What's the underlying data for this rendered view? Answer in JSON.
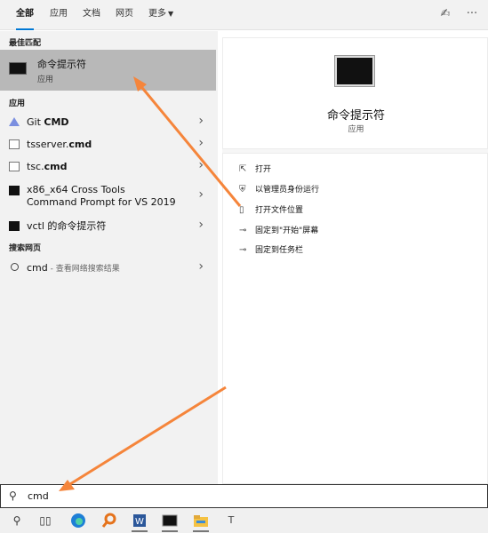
{
  "tabs": [
    {
      "label": "全部"
    },
    {
      "label": "应用"
    },
    {
      "label": "文档"
    },
    {
      "label": "网页"
    },
    {
      "label": "更多"
    }
  ],
  "sections": {
    "best_match": "最佳匹配",
    "apps": "应用",
    "web": "搜索网页"
  },
  "best_match": {
    "title": "命令提示符",
    "subtitle": "应用"
  },
  "apps": [
    {
      "prefix": "Git ",
      "bold": "CMD",
      "suffix": "",
      "icon": "git-icon"
    },
    {
      "prefix": "tsserver.",
      "bold": "cmd",
      "suffix": "",
      "icon": "file-icon"
    },
    {
      "prefix": "tsc.",
      "bold": "cmd",
      "suffix": "",
      "icon": "file-icon"
    },
    {
      "prefix": "x86_x64 Cross Tools Command Prompt for VS 2019",
      "bold": "",
      "suffix": "",
      "icon": "terminal-icon"
    },
    {
      "prefix": "vctl 的命令提示符",
      "bold": "",
      "suffix": "",
      "icon": "terminal-icon"
    }
  ],
  "web_result": {
    "query": "cmd",
    "hint": " - 查看网络搜索结果"
  },
  "detail": {
    "title": "命令提示符",
    "subtitle": "应用"
  },
  "actions": [
    {
      "label": "打开",
      "icon": "open-icon",
      "glyph": "⇱"
    },
    {
      "label": "以管理员身份运行",
      "icon": "shield-icon",
      "glyph": "⛨"
    },
    {
      "label": "打开文件位置",
      "icon": "folder-location-icon",
      "glyph": "▯"
    },
    {
      "label": "固定到\"开始\"屏幕",
      "icon": "pin-icon",
      "glyph": "⊸"
    },
    {
      "label": "固定到任务栏",
      "icon": "pin-icon",
      "glyph": "⊸"
    }
  ],
  "search": {
    "value": "cmd"
  },
  "colors": {
    "accent": "#0078d4",
    "highlight": "#b8b8b8",
    "annotation_arrow": "#f5853b"
  },
  "taskbar": [
    "search-icon",
    "task-view-icon",
    "edge-icon",
    "search-app-icon",
    "word-icon",
    "terminal-icon",
    "file-explorer-icon",
    "typora-icon"
  ]
}
